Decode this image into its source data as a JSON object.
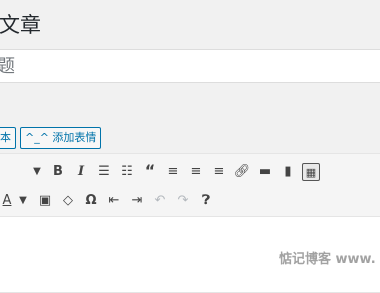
{
  "header": {
    "title": "文章"
  },
  "title_field": {
    "value": "",
    "placeholder": "题"
  },
  "media_buttons": {
    "text_tab": "本",
    "emoji_button": "^_^ 添加表情"
  },
  "toolbar_row1": [
    "▾",
    "B",
    "I",
    "bulleted-list",
    "numbered-list",
    "blockquote",
    "align-left",
    "align-center",
    "align-right",
    "insert-link",
    "read-more",
    "toolbar-toggle",
    "keyboard"
  ],
  "toolbar_row2": [
    "text-color",
    "▾",
    "paste-as-text",
    "clear-formatting",
    "Ω",
    "outdent",
    "indent",
    "undo",
    "redo",
    "?"
  ],
  "watermark": "惦记博客 www."
}
